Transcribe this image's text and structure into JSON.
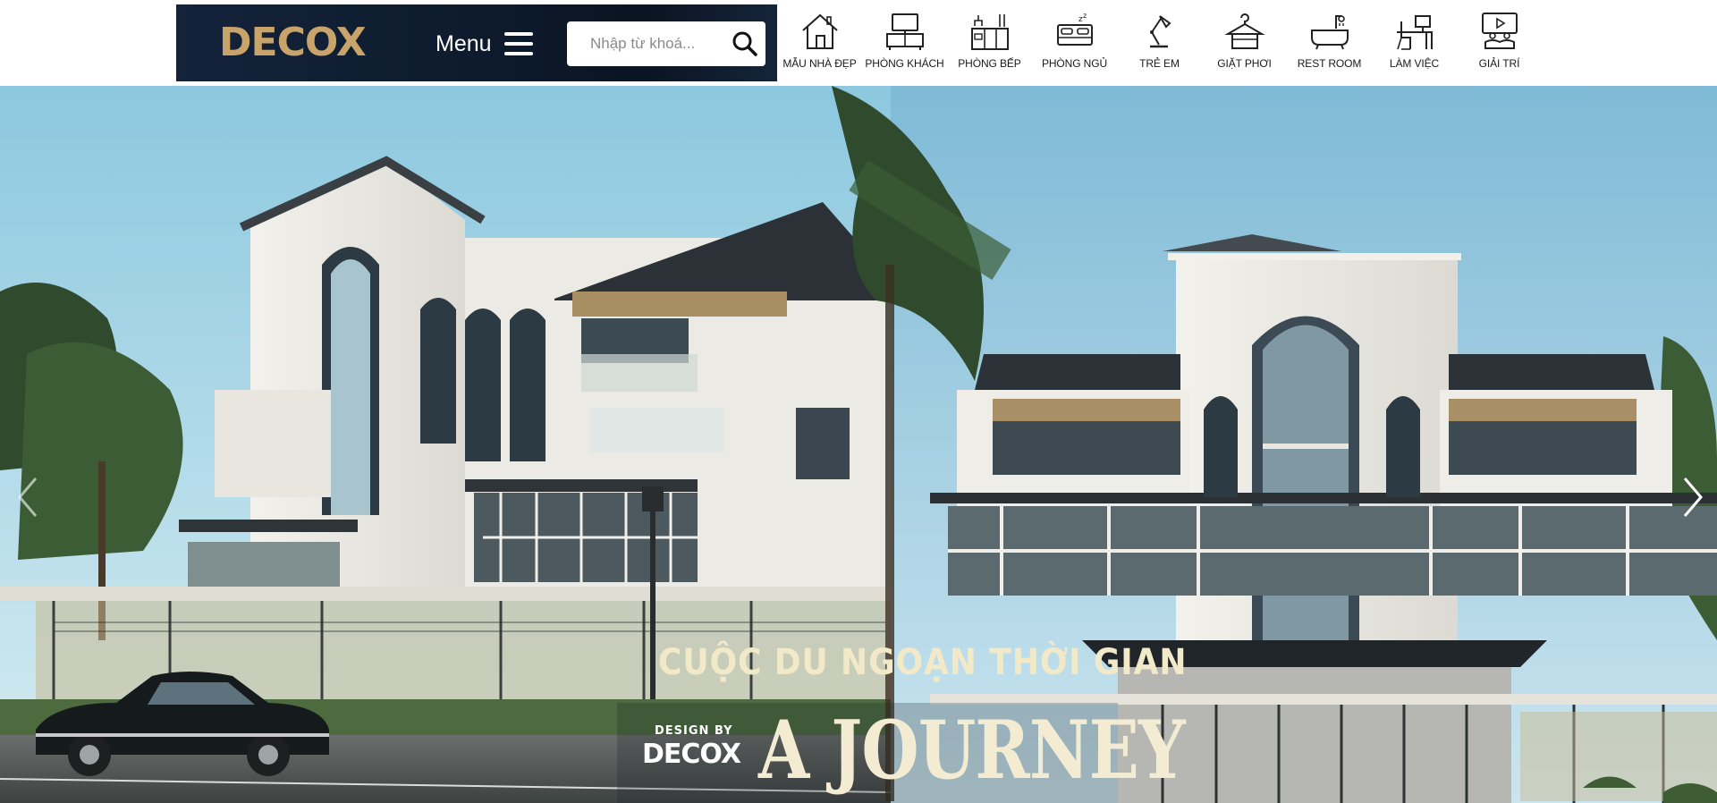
{
  "header": {
    "logo_text": "DECOX",
    "menu_label": "Menu",
    "search": {
      "placeholder": "Nhập từ khoá...",
      "value": ""
    },
    "categories": [
      {
        "label": "MẪU NHÀ ĐẸP",
        "icon": "house-icon"
      },
      {
        "label": "PHÒNG KHÁCH",
        "icon": "tv-cabinet-icon"
      },
      {
        "label": "PHÒNG BẾP",
        "icon": "kitchen-icon"
      },
      {
        "label": "PHÒNG NGỦ",
        "icon": "bed-icon"
      },
      {
        "label": "TRẺ EM",
        "icon": "desk-lamp-icon"
      },
      {
        "label": "GIẶT PHƠI",
        "icon": "hanger-icon"
      },
      {
        "label": "REST ROOM",
        "icon": "bathtub-icon"
      },
      {
        "label": "LÀM VIỆC",
        "icon": "workstation-icon"
      },
      {
        "label": "GIẢI TRÍ",
        "icon": "home-theater-icon"
      }
    ]
  },
  "hero": {
    "caption_line1": "CUỘC DU NGOẠN THỜI GIAN",
    "caption_design_by": "DESIGN BY",
    "caption_logo": "DECOX",
    "caption_big": "A JOURNEY"
  },
  "colors": {
    "brand_gold": "#c9a46a",
    "header_dark": "#0d1a2c",
    "sky": "#9fd0e6",
    "caption_cream": "#f1e9c8"
  }
}
